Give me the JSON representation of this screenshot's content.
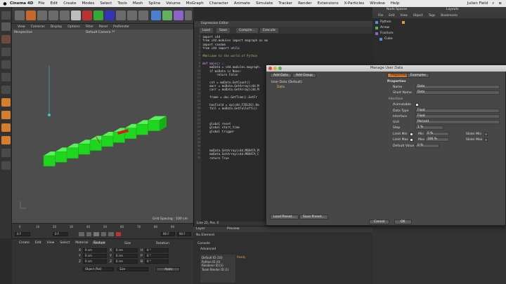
{
  "menubar": {
    "app": "Cinema 4D",
    "items": [
      "File",
      "Edit",
      "Create",
      "Modes",
      "Select",
      "Tools",
      "Mesh",
      "Spline",
      "Volume",
      "MoGraph",
      "Character",
      "Animate",
      "Simulate",
      "Tracker",
      "Render",
      "Extensions",
      "X-Particles",
      "Window",
      "Help"
    ],
    "user": "Julien Field"
  },
  "viewport": {
    "menu": [
      "View",
      "Cameras",
      "Display",
      "Options",
      "Filter",
      "Panel",
      "ProRender"
    ],
    "mode_label": "Perspective",
    "camera_label": "Default Camera ?*",
    "grid_spacing": "Grid Spacing : 100 cm",
    "cube_count": 10
  },
  "timeline": {
    "ticks": [
      "0",
      "10",
      "20",
      "30",
      "40",
      "50",
      "60",
      "70",
      "80",
      "90"
    ],
    "current_frame": "0 F",
    "start_field": "0 F",
    "end_field": "90 F",
    "frame_field": "90 F"
  },
  "coords": {
    "menu": [
      "Create",
      "Edit",
      "View",
      "Select",
      "Material",
      "Texture"
    ],
    "headers": [
      "Position",
      "Size",
      "Rotation"
    ],
    "rows": [
      {
        "a": "X",
        "pos": "0 cm",
        "s": "X",
        "size": "0 cm",
        "r": "H",
        "rot": "0 °"
      },
      {
        "a": "Y",
        "pos": "0 cm",
        "s": "Y",
        "size": "0 cm",
        "r": "P",
        "rot": "0 °"
      },
      {
        "a": "Z",
        "pos": "0 cm",
        "s": "Z",
        "size": "0 cm",
        "r": "B",
        "rot": "0 °"
      }
    ],
    "mode_select": "Object (Rel)",
    "size_select": "Size",
    "apply_label": "Apply"
  },
  "expression": {
    "title": "Expression Editor",
    "tabs": [
      "Load",
      "Save",
      "Compile...",
      "Execute"
    ],
    "code": [
      {
        "t": "import c4d",
        "c": ""
      },
      {
        "t": "from c4d.modules import mograph as mo",
        "c": ""
      },
      {
        "t": "import random",
        "c": ""
      },
      {
        "t": "from c4d import utils",
        "c": ""
      },
      {
        "t": "",
        "c": ""
      },
      {
        "t": "#Welcome to the world of Python",
        "c": "cm"
      },
      {
        "t": "",
        "c": ""
      },
      {
        "t": "def main() :",
        "c": "kw"
      },
      {
        "t": "    moData = c4d.modules.mograph.",
        "c": ""
      },
      {
        "t": "    if moData is None:",
        "c": ""
      },
      {
        "t": "        return False",
        "c": ""
      },
      {
        "t": "",
        "c": ""
      },
      {
        "t": "    cnt = moData.GetCount()",
        "c": ""
      },
      {
        "t": "    marr = moData.GetArray(c4d.M",
        "c": ""
      },
      {
        "t": "    carr = moData.GetArray(c4d.M",
        "c": ""
      },
      {
        "t": "",
        "c": ""
      },
      {
        "t": "    frame = doc.GetTime().GetFr",
        "c": ""
      },
      {
        "t": "",
        "c": ""
      },
      {
        "t": "    hasField = op[c4d.FIELDS].Ha",
        "c": ""
      },
      {
        "t": "    fall = moData.GetFalloffs()",
        "c": ""
      },
      {
        "t": "",
        "c": ""
      },
      {
        "t": "",
        "c": ""
      },
      {
        "t": "",
        "c": ""
      },
      {
        "t": "    global reset",
        "c": ""
      },
      {
        "t": "    global start_time",
        "c": ""
      },
      {
        "t": "    global trigger",
        "c": ""
      },
      {
        "t": "",
        "c": ""
      },
      {
        "t": "",
        "c": ""
      },
      {
        "t": "",
        "c": ""
      },
      {
        "t": "",
        "c": ""
      },
      {
        "t": "    moData.SetArray(c4d.MODATA_M",
        "c": ""
      },
      {
        "t": "    moData.SetArray(c4d.MODATA_C",
        "c": ""
      },
      {
        "t": "    return True",
        "c": ""
      }
    ],
    "status": "Line 22, Pos. 0"
  },
  "dialog": {
    "title": "Manage User Data",
    "add_data": "Add Data",
    "add_group": "Add Group",
    "tree_root": "User Data (Default)",
    "tree_child": "Data",
    "load_preset": "Load Preset...",
    "save_preset": "Save Preset...",
    "tabs": [
      "Properties",
      "Examples"
    ],
    "section": "Properties",
    "props": [
      {
        "label": "Name",
        "value": "Data"
      },
      {
        "label": "Short Name",
        "value": "Data"
      }
    ],
    "sub_section": "Interface",
    "animatable": "Animatable",
    "props2": [
      {
        "label": "Data Type",
        "value": "Float"
      },
      {
        "label": "Interface",
        "value": "Float"
      },
      {
        "label": "Unit",
        "value": "Percent"
      },
      {
        "label": "Step",
        "value": "1 %"
      }
    ],
    "limit_min": "Limit Min",
    "min_label": "Min",
    "min_value": "0 %",
    "slider_min": "Slider Min",
    "limit_max": "Limit Max",
    "max_label": "Max",
    "max_value": "100 %",
    "slider_max": "Slider Max",
    "default_label": "Default Value",
    "default_value": "0 %",
    "cancel": "Cancel",
    "ok": "OK"
  },
  "objects": {
    "title": "Node Spaces",
    "layouts": "Layouts",
    "menu": [
      "File",
      "Edit",
      "View",
      "Object",
      "Tags",
      "Bookmarks"
    ],
    "items": [
      "Python",
      "Arrow",
      "Fracture",
      "Cube"
    ]
  },
  "lowmid": {
    "tabs": [
      "Layer",
      "Preview"
    ],
    "basic_title": "No Element",
    "console_label": "Console",
    "advanced_label": "Advanced",
    "lines": [
      "Default ID (10)",
      "Python ID (0)",
      "Renderer ID (1)",
      "Team Render ID (1)"
    ],
    "log_text": "Ready"
  },
  "colors": {
    "cube_green": "#1fd61f",
    "accent_orange": "#cf7a2a",
    "arrow_red": "#cc2222"
  }
}
